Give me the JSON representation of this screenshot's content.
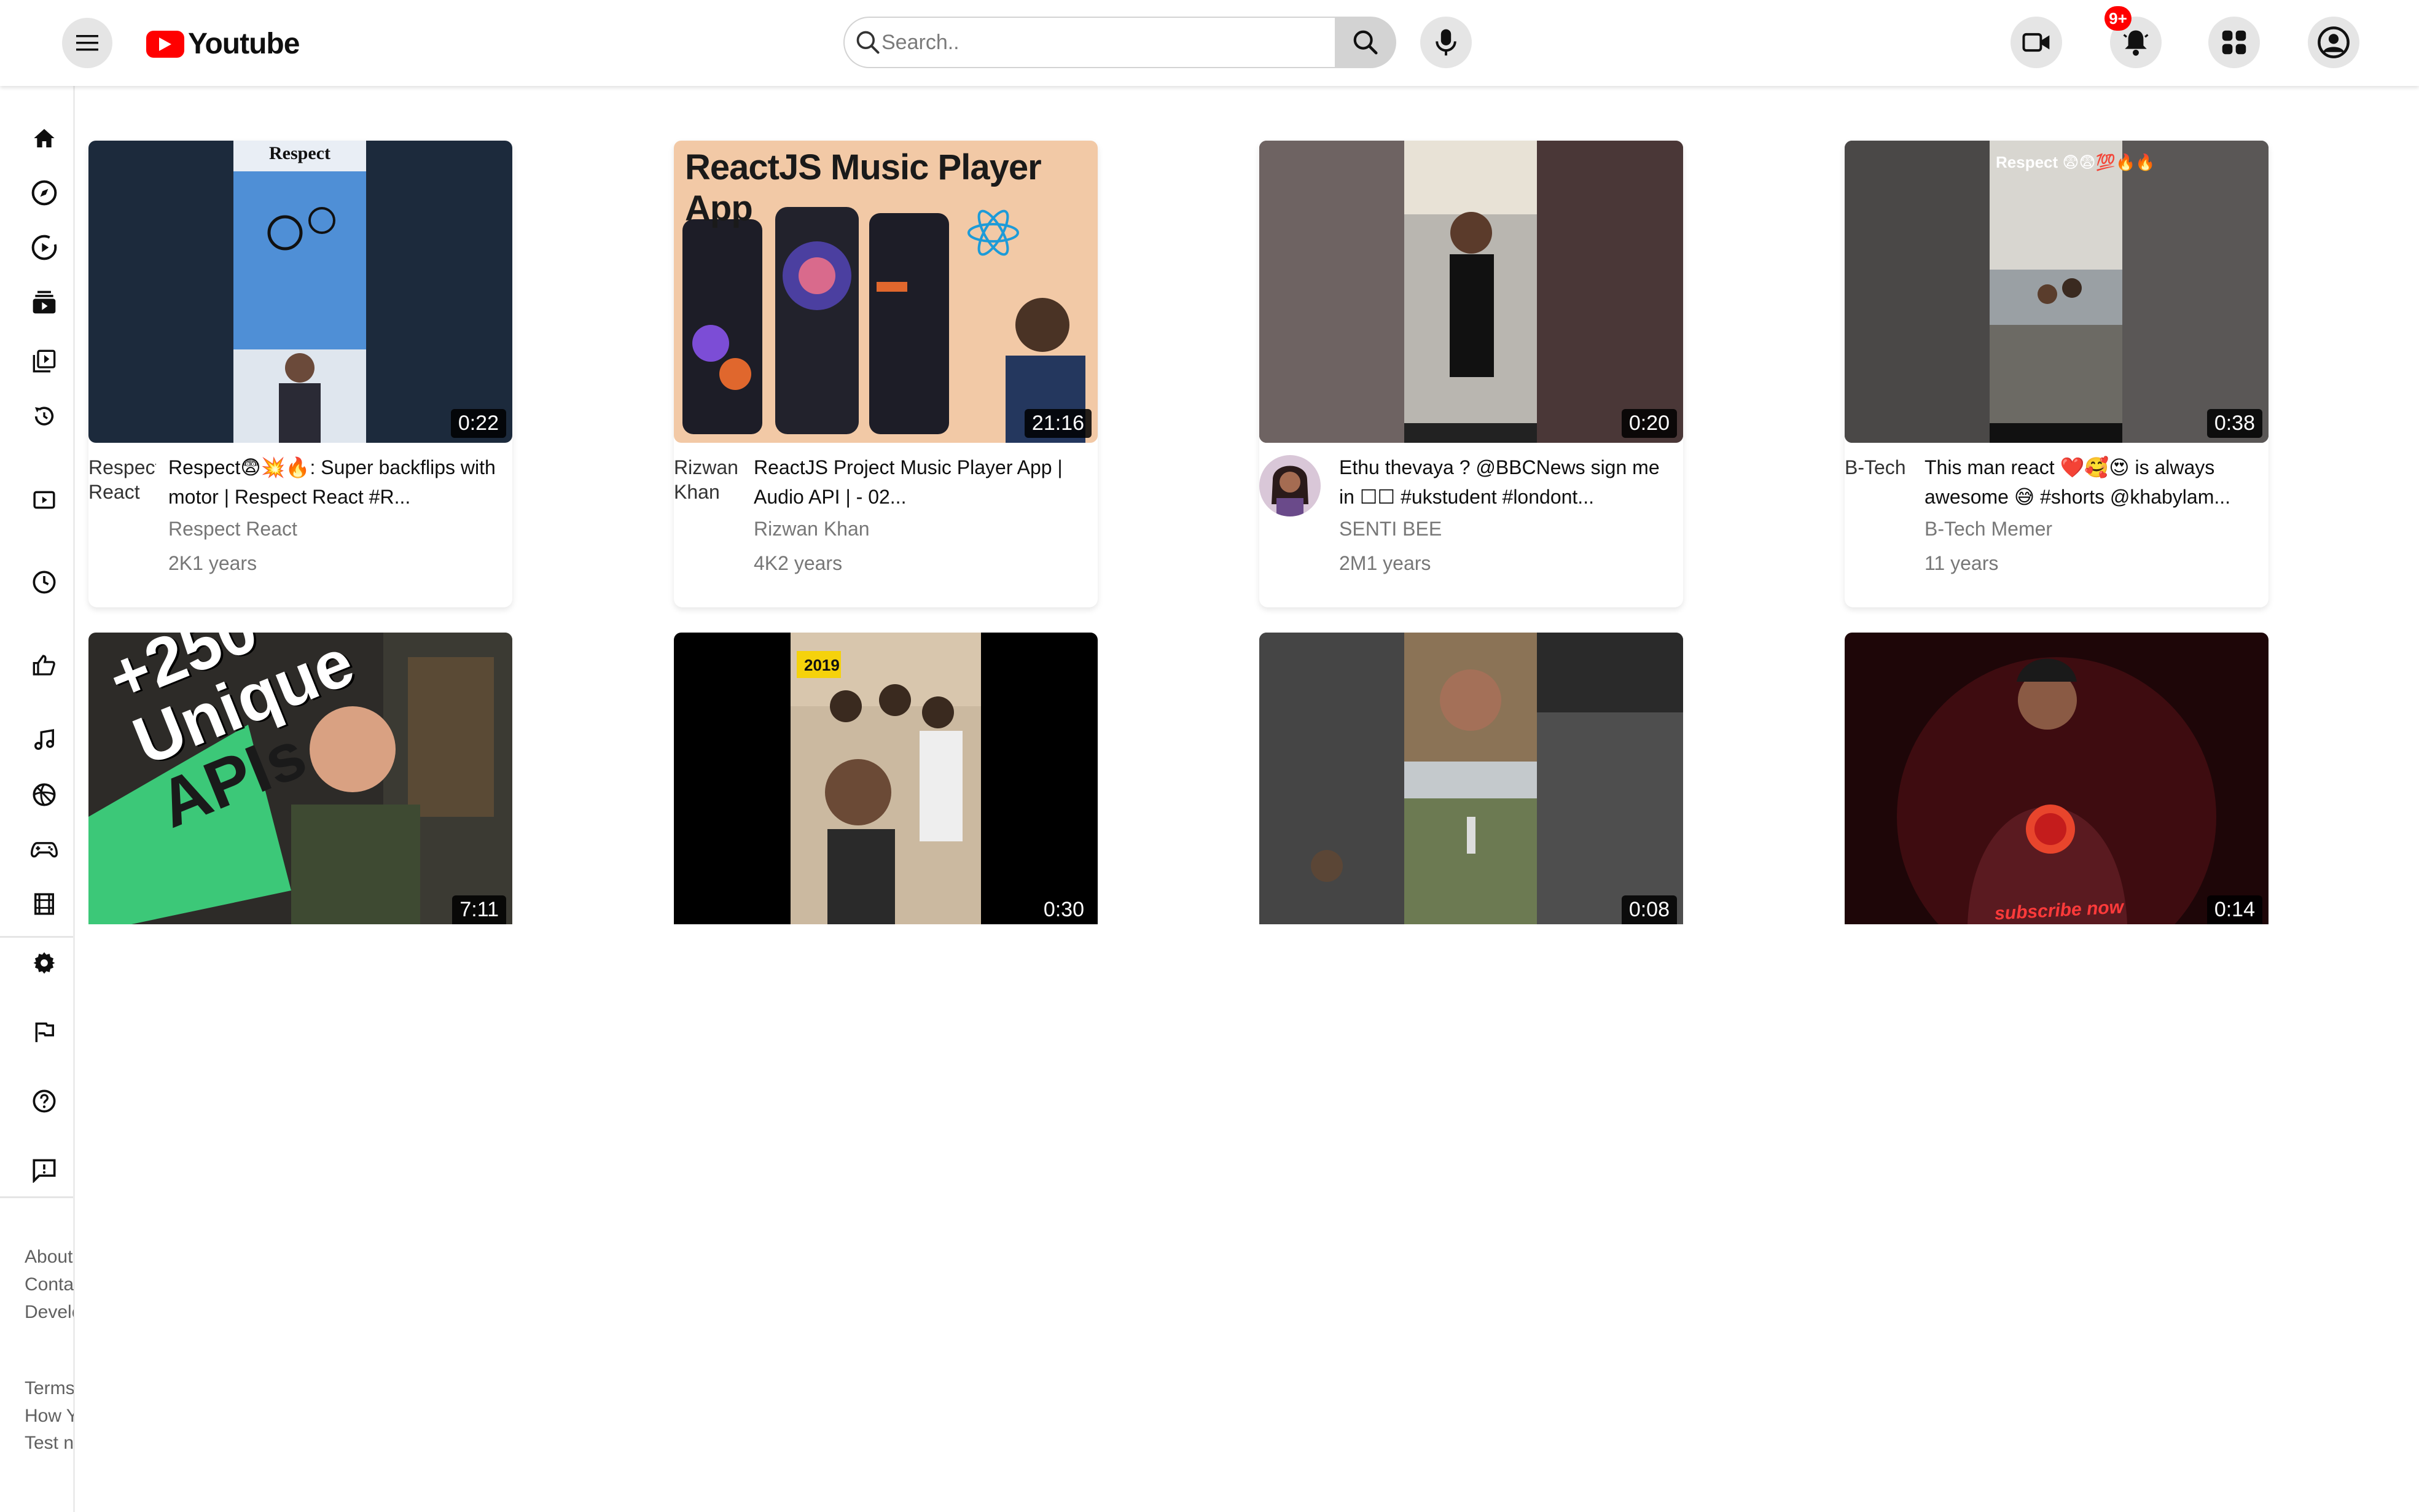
{
  "header": {
    "logo_text": "Youtube",
    "search_placeholder": "Search..",
    "notification_count": "9+"
  },
  "sidebar": {
    "icons": [
      "home-icon",
      "explore-icon",
      "shorts-icon",
      "subscriptions-icon",
      "library-icon",
      "history-icon",
      "your-videos-icon",
      "watch-later-icon",
      "liked-videos-icon",
      "music-icon",
      "sports-icon",
      "gaming-icon",
      "movies-icon",
      "settings-icon",
      "report-icon",
      "help-icon",
      "feedback-icon"
    ],
    "links_1": [
      "About",
      "Contact",
      "Developers"
    ],
    "links_2": [
      "Terms",
      "How YouTube works",
      "Test new features"
    ]
  },
  "videos": [
    {
      "title": "Respect😨💥🔥: Super backflips with motor | Respect React #R...",
      "channel": "Respect React",
      "views": "2K1 years",
      "duration": "0:22",
      "avatar_alt": "Respect React"
    },
    {
      "title": "ReactJS Project Music Player App | Audio API | - 02...",
      "channel": "Rizwan Khan",
      "views": "4K2 years",
      "duration": "21:16",
      "avatar_alt": "Rizwan Khan",
      "thumb_text": "ReactJS Music Player App"
    },
    {
      "title": "Ethu thevaya ? @BBCNews sign me in ☐☐ #ukstudent #londont...",
      "channel": "SENTI BEE",
      "views": "2M1 years",
      "duration": "0:20"
    },
    {
      "title": "This man react ❤️🥰😍 is always awesome 😅 #shorts @khabylam...",
      "channel": "B-Tech Memer",
      "views": "11 years",
      "duration": "0:38",
      "avatar_alt": "B-Tech",
      "thumb_text": "Respect 😨😨💯🔥🔥"
    },
    {
      "duration": "7:11",
      "thumb_text_1": "+250",
      "thumb_text_2": "Unique",
      "thumb_text_3": "APIs"
    },
    {
      "duration": "0:30",
      "thumb_text": "2019"
    },
    {
      "duration": "0:08"
    },
    {
      "duration": "0:14",
      "thumb_text": "subscribe now"
    }
  ],
  "colors": {
    "brand_red": "#ff0000",
    "badge_red": "#ff0000"
  }
}
